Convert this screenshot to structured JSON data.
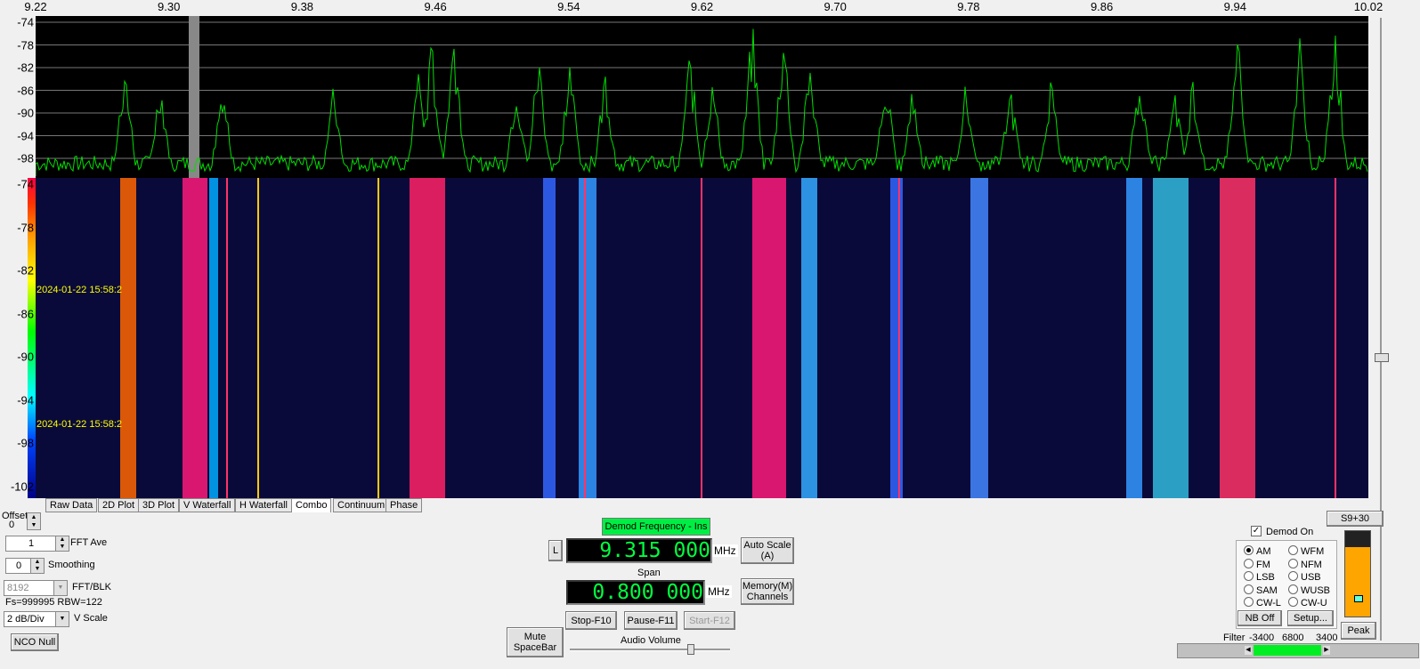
{
  "freq_axis": {
    "ticks": [
      "9.22",
      "9.30",
      "9.38",
      "9.46",
      "9.54",
      "9.62",
      "9.70",
      "9.78",
      "9.86",
      "9.94",
      "10.02"
    ]
  },
  "spectrum": {
    "y_ticks": [
      "-74",
      "-78",
      "-82",
      "-86",
      "-90",
      "-94",
      "-98"
    ]
  },
  "waterfall": {
    "y_ticks": [
      "-74",
      "-78",
      "-82",
      "-86",
      "-90",
      "-94",
      "-98",
      "-102"
    ],
    "timestamps": [
      "2024-01-22 15:58:2",
      "2024-01-22 15:58:2"
    ]
  },
  "tabs": [
    "Raw Data",
    "2D Plot",
    "3D Plot",
    "V Waterfall",
    "H Waterfall",
    "Combo",
    "Continuum",
    "Phase"
  ],
  "left_panel": {
    "offset_label": "Offset",
    "offset_value": "0",
    "fft_ave_value": "1",
    "fft_ave_label": "FFT Ave",
    "smoothing_value": "0",
    "smoothing_label": "Smoothing",
    "fft_blk_value": "8192",
    "fft_blk_label": "FFT/BLK",
    "fs_rbw": "Fs=999995 RBW=122",
    "vscale_value": "2 dB/Div",
    "vscale_label": "V Scale",
    "nco_null": "NCO Null"
  },
  "center_panel": {
    "demod_freq_btn": "Demod Frequency - Ins",
    "l_btn": "L",
    "demod_freq_value": "9.315 000",
    "mhz_unit": "MHz",
    "auto_scale": "Auto Scale (A)",
    "span_label": "Span",
    "span_value": "0.800 000",
    "span_unit": "MHz",
    "memory_channels": "Memory(M) Channels",
    "stop": "Stop-F10",
    "pause": "Pause-F11",
    "start": "Start-F12",
    "mute": "Mute SpaceBar",
    "audio_volume": "Audio Volume"
  },
  "right_panel": {
    "s_meter_btn": "S9+30",
    "demod_on_label": "Demod On",
    "modes_left": [
      "AM",
      "FM",
      "LSB",
      "SAM",
      "CW-L"
    ],
    "modes_right": [
      "WFM",
      "NFM",
      "USB",
      "WUSB",
      "CW-U"
    ],
    "selected_mode": "AM",
    "nb_off": "NB Off",
    "setup": "Setup...",
    "peak": "Peak",
    "filter_label": "Filter",
    "filter_low": "-3400",
    "filter_width": "6800",
    "filter_high": "3400"
  },
  "colors": {
    "spectrum_trace": "#00dd00",
    "background": "#000000",
    "accent_green": "#00ff40",
    "meter_fill": "#ffa500"
  }
}
